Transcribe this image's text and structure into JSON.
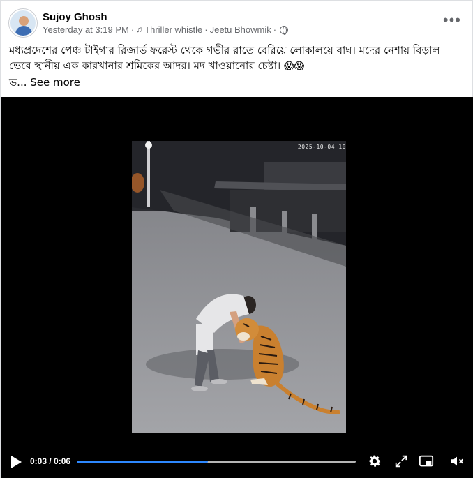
{
  "post": {
    "author": "Sujoy Ghosh",
    "time": "Yesterday at 3:19 PM",
    "separator": "·",
    "audio": "Thriller whistle",
    "tagged": "Jeetu Bhowmik",
    "more_label": "•••",
    "text_line1": "মধ্যপ্রদেশের পেঞ্চ টাইগার রিজার্ভ ফরেস্ট থেকে গভীর রাতে বেরিয়ে লোকালয়ে বাঘ। মদের নেশায় বিড়াল",
    "text_line2": "ভেবে স্থানীয় এক কারখানার শ্রমিকের আদর। মদ খাওয়ানোর চেষ্টা।",
    "emoji": "😱😱",
    "truncated_prefix": "ভ...",
    "see_more": "See more"
  },
  "video": {
    "timestamp": "2025-10-04  10",
    "current_time": "0:03 / 0:06",
    "progress_fraction": 0.47
  },
  "icons": {
    "play": "play-icon",
    "settings": "gear-icon",
    "fullscreen": "expand-icon",
    "pip": "picture-in-picture-icon",
    "volume": "speaker-muted-icon",
    "globe": "globe-icon",
    "audio": "music-note-icon",
    "more": "more-options-icon"
  }
}
